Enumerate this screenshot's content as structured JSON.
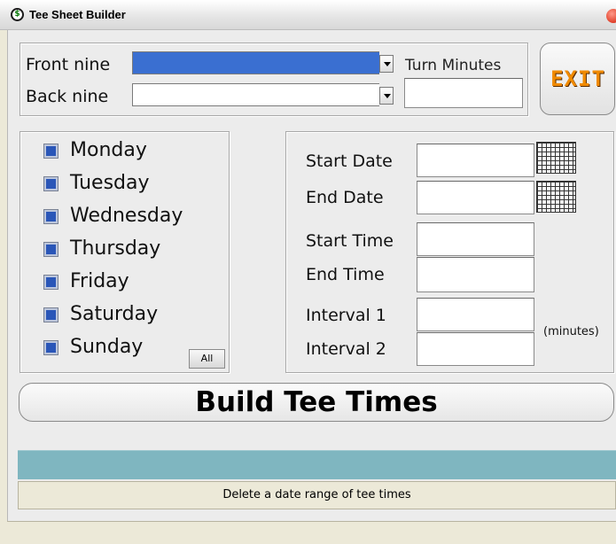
{
  "window": {
    "title": "Tee Sheet Builder"
  },
  "courses": {
    "front_nine_label": "Front nine",
    "front_nine_value": "",
    "back_nine_label": "Back nine",
    "back_nine_value": "",
    "turn_minutes_label": "Turn Minutes",
    "turn_minutes_value": ""
  },
  "exit_button": {
    "label": "EXIT"
  },
  "days": {
    "items": [
      "Monday",
      "Tuesday",
      "Wednesday",
      "Thursday",
      "Friday",
      "Saturday",
      "Sunday"
    ],
    "all_label": "All"
  },
  "schedule": {
    "start_date_label": "Start Date",
    "start_date_value": "",
    "end_date_label": "End Date",
    "end_date_value": "",
    "start_time_label": "Start Time",
    "start_time_value": "",
    "end_time_label": "End Time",
    "end_time_value": "",
    "interval1_label": "Interval 1",
    "interval1_value": "",
    "interval2_label": "Interval 2",
    "interval2_value": "",
    "minutes_note": "(minutes)"
  },
  "actions": {
    "build_label": "Build Tee Times",
    "delete_label": "Delete a date range of tee times"
  },
  "colors": {
    "selection": "#3a6fd1",
    "progress": "#7fb6c0",
    "exit_accent": "#f08a00"
  }
}
